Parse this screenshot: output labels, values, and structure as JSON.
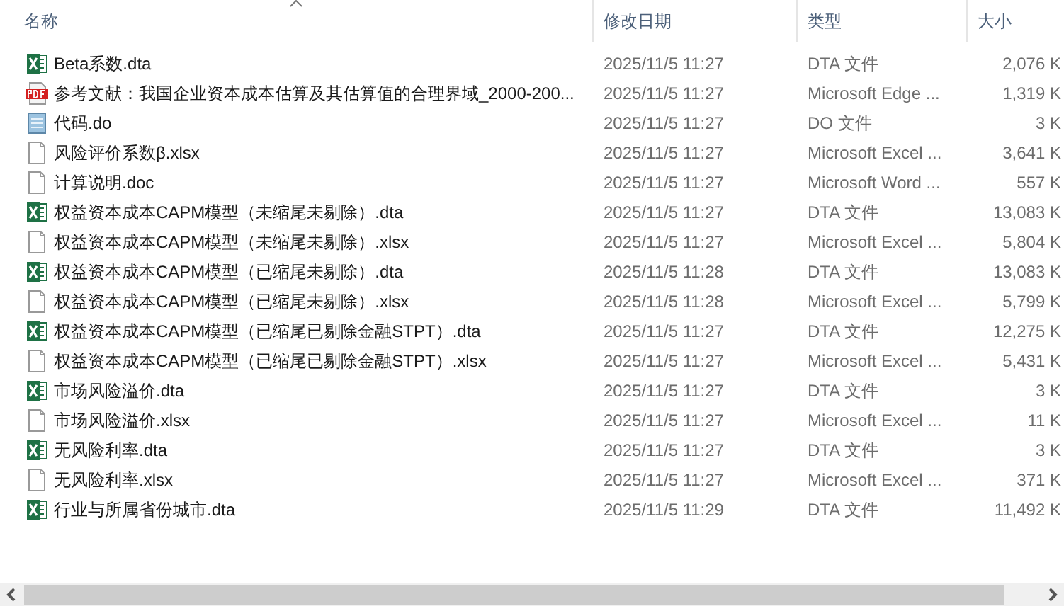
{
  "columns": [
    {
      "label": "名称",
      "sorted": true
    },
    {
      "label": "修改日期",
      "sorted": false
    },
    {
      "label": "类型",
      "sorted": false
    },
    {
      "label": "大小",
      "sorted": false
    }
  ],
  "rows": [
    {
      "kind": "excel",
      "name": "Beta系数.dta",
      "modified": "2025/11/5 11:27",
      "type": "DTA 文件",
      "size": "2,076 K"
    },
    {
      "kind": "pdf",
      "name": "参考文献：我国企业资本成本估算及其估算值的合理界域_2000-200...",
      "modified": "2025/11/5 11:27",
      "type": "Microsoft Edge ...",
      "size": "1,319 K"
    },
    {
      "kind": "notepad",
      "name": "代码.do",
      "modified": "2025/11/5 11:27",
      "type": "DO 文件",
      "size": "3 K"
    },
    {
      "kind": "blank",
      "name": "风险评价系数β.xlsx",
      "modified": "2025/11/5 11:27",
      "type": "Microsoft Excel ...",
      "size": "3,641 K"
    },
    {
      "kind": "blank",
      "name": "计算说明.doc",
      "modified": "2025/11/5 11:27",
      "type": "Microsoft Word ...",
      "size": "557 K"
    },
    {
      "kind": "excel",
      "name": "权益资本成本CAPM模型（未缩尾未剔除）.dta",
      "modified": "2025/11/5 11:27",
      "type": "DTA 文件",
      "size": "13,083 K"
    },
    {
      "kind": "blank",
      "name": "权益资本成本CAPM模型（未缩尾未剔除）.xlsx",
      "modified": "2025/11/5 11:27",
      "type": "Microsoft Excel ...",
      "size": "5,804 K"
    },
    {
      "kind": "excel",
      "name": "权益资本成本CAPM模型（已缩尾未剔除）.dta",
      "modified": "2025/11/5 11:28",
      "type": "DTA 文件",
      "size": "13,083 K"
    },
    {
      "kind": "blank",
      "name": "权益资本成本CAPM模型（已缩尾未剔除）.xlsx",
      "modified": "2025/11/5 11:28",
      "type": "Microsoft Excel ...",
      "size": "5,799 K"
    },
    {
      "kind": "excel",
      "name": "权益资本成本CAPM模型（已缩尾已剔除金融STPT）.dta",
      "modified": "2025/11/5 11:27",
      "type": "DTA 文件",
      "size": "12,275 K"
    },
    {
      "kind": "blank",
      "name": "权益资本成本CAPM模型（已缩尾已剔除金融STPT）.xlsx",
      "modified": "2025/11/5 11:27",
      "type": "Microsoft Excel ...",
      "size": "5,431 K"
    },
    {
      "kind": "excel",
      "name": "市场风险溢价.dta",
      "modified": "2025/11/5 11:27",
      "type": "DTA 文件",
      "size": "3 K"
    },
    {
      "kind": "blank",
      "name": "市场风险溢价.xlsx",
      "modified": "2025/11/5 11:27",
      "type": "Microsoft Excel ...",
      "size": "11 K"
    },
    {
      "kind": "excel",
      "name": "无风险利率.dta",
      "modified": "2025/11/5 11:27",
      "type": "DTA 文件",
      "size": "3 K"
    },
    {
      "kind": "blank",
      "name": "无风险利率.xlsx",
      "modified": "2025/11/5 11:27",
      "type": "Microsoft Excel ...",
      "size": "371 K"
    },
    {
      "kind": "excel",
      "name": "行业与所属省份城市.dta",
      "modified": "2025/11/5 11:29",
      "type": "DTA 文件",
      "size": "11,492 K"
    }
  ]
}
